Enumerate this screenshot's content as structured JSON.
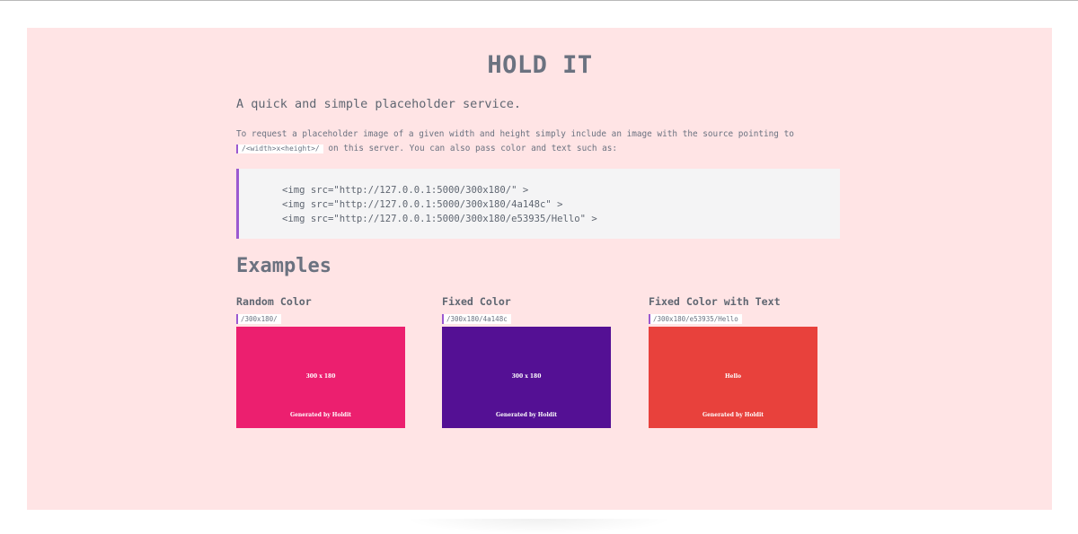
{
  "header": {
    "title": "HOLD IT",
    "tagline": "A quick and simple placeholder service."
  },
  "intro": {
    "text_before": "To request a placeholder image of a given width and height simply include an image with the source pointing to",
    "code": "/<width>x<height>/",
    "text_after": "on this server. You can also pass color and text such as:"
  },
  "code_examples": [
    "<img src=\"http://127.0.0.1:5000/300x180/\" >",
    "<img src=\"http://127.0.0.1:5000/300x180/4a148c\" >",
    "<img src=\"http://127.0.0.1:5000/300x180/e53935/Hello\" >"
  ],
  "examples_heading": "Examples",
  "examples": [
    {
      "title": "Random Color",
      "path": "/300x180/",
      "color": "#ec1f6f",
      "main_text": "300 x 180",
      "footer_text": "Generated by Holdit"
    },
    {
      "title": "Fixed Color",
      "path": "/300x180/4a148c",
      "color": "#541094",
      "main_text": "300 x 180",
      "footer_text": "Generated by Holdit"
    },
    {
      "title": "Fixed Color with Text",
      "path": "/300x180/e53935/Hello",
      "color": "#e8413c",
      "main_text": "Hello",
      "footer_text": "Generated by Holdit"
    }
  ],
  "colors": {
    "panel_background": "#ffe4e5",
    "accent": "#9b59d0",
    "text": "#6b7280"
  }
}
